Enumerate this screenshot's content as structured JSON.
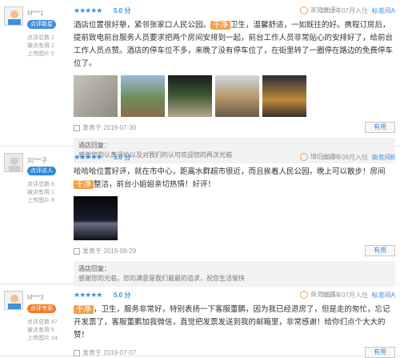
{
  "reviews": [
    {
      "user": "M***1",
      "badge": "点评新星",
      "stats": [
        "点评总数 1",
        "被点有用 1",
        "上传图片 5"
      ],
      "stars": "★★★★★",
      "score": "5.0 分",
      "tag": "家庭亲子",
      "date": "2019年07月入住",
      "roomtype": "标准间A",
      "text_before": "酒店位置很好挚，紧邻张家口人民公园。",
      "highlight": "干净",
      "text_after": "卫生，温馨舒适，一如既往的好。携程订房后，提前致电前台服务人员要求把两个房间安排到一起，前台工作人员非常贴心的安排好了，给前台工作人员点赞。酒店的停车位不多，来晚了没有停车位了，在街里转了一圈停在路边的免费停车位了。",
      "posted": "发表于 2019-07-30",
      "useful": "有用",
      "reply_title": "酒店回复：",
      "reply_text": "感谢您的认真评价以及对我们的认可欢迎您的再次光临"
    },
    {
      "user": "刘***子",
      "badge": "点评达人",
      "stats": [
        "点评总数 6",
        "被点有用 1",
        "上传图片 8"
      ],
      "stars": "★★★★★",
      "score": "5.0 分",
      "tag": "情侣出游",
      "date": "2019年08月入住",
      "roomtype": "商务间B",
      "text_before": "哈哈哈位置好评，就在市中心，距离水群超市很近，而且挨着人民公园，晚上可以散步！房间",
      "highlight": "干净",
      "text_after": "整洁，前台小姐姐亲切热情！好评！",
      "posted": "发表于 2019-08-29",
      "useful": "有用",
      "reply_title": "酒店回复：",
      "reply_text": "感谢您的光临，您的满意是我们最最的追求，祝您生活愉快"
    },
    {
      "user": "M***3",
      "badge": "点评专家",
      "stats": [
        "点评总数 47",
        "被点有用 5",
        "上传图片 14"
      ],
      "stars": "★★★★★",
      "score": "5.0 分",
      "tag": "商务出差",
      "date": "2019年07月入住",
      "roomtype": "标准间A",
      "text_before": "",
      "highlight": "干净",
      "text_after": "，卫生，服务非常好，特别表扬一下客服董鹏，因为我已经退房了，但是走的匆忙，忘记开发票了，客服董鹏加我微信，直觉把发票发送到我的邮箱里，非常感谢！给你们点个大大的赞！",
      "posted": "发表于 2019-07-07",
      "useful": "有用"
    }
  ]
}
